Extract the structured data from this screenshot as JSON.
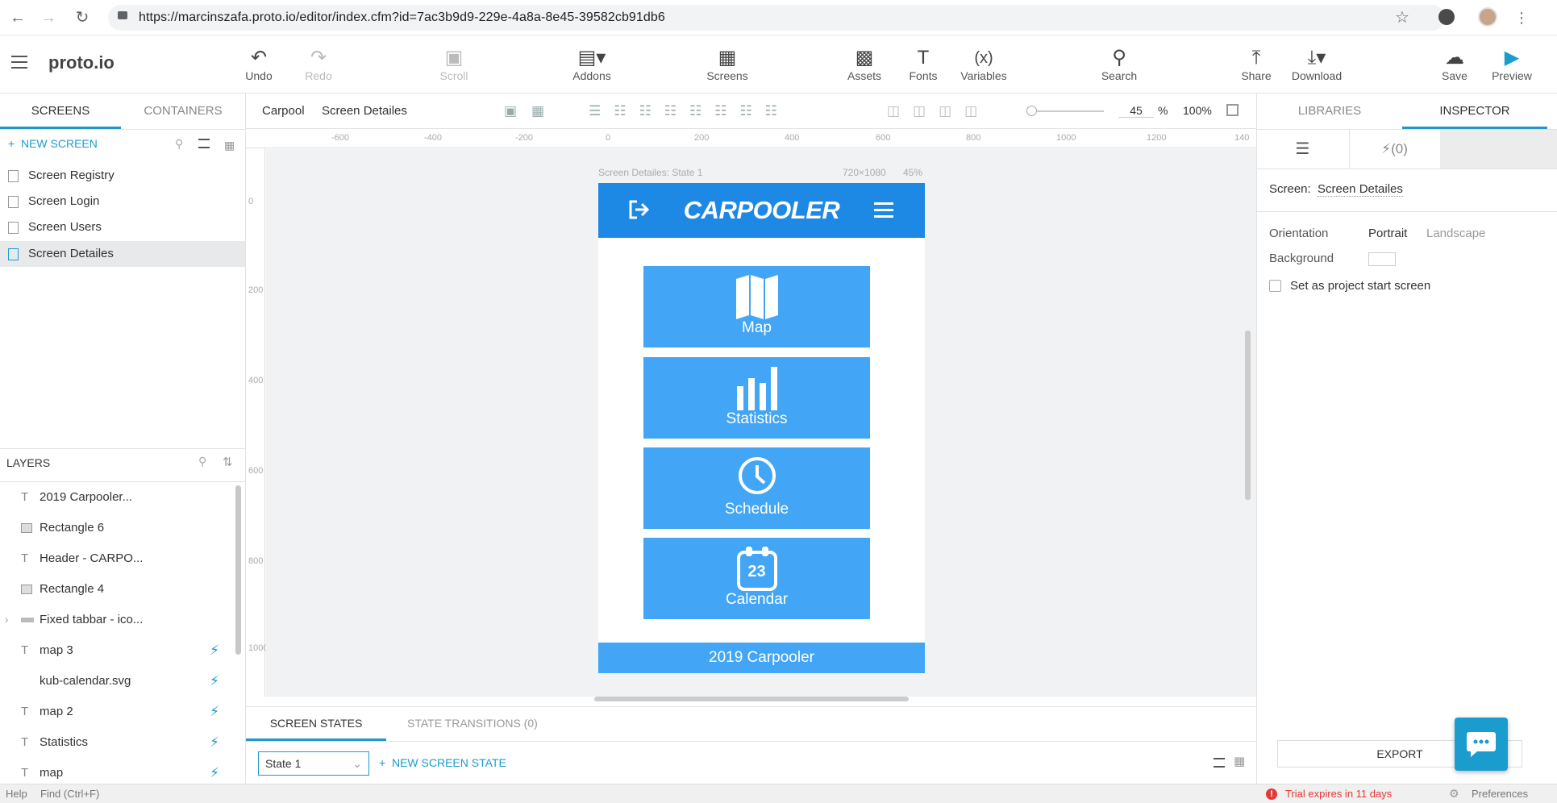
{
  "browser": {
    "url": "https://marcinszafa.proto.io/editor/index.cfm?id=7ac3b9d9-229e-4a8a-8e45-39582cb91db6"
  },
  "app": {
    "logo": "proto.io"
  },
  "toolbar": {
    "undo": "Undo",
    "redo": "Redo",
    "scroll": "Scroll",
    "addons": "Addons",
    "screens": "Screens",
    "assets": "Assets",
    "fonts": "Fonts",
    "variables": "Variables",
    "variables_icon": "(x)",
    "search": "Search",
    "share": "Share",
    "download": "Download",
    "save": "Save",
    "preview": "Preview"
  },
  "left": {
    "tabs": [
      "SCREENS",
      "CONTAINERS"
    ],
    "new_screen": "NEW SCREEN",
    "screens": [
      "Screen Registry",
      "Screen Login",
      "Screen Users",
      "Screen Detailes"
    ],
    "layers_title": "LAYERS",
    "layers": [
      "2019 Carpooler...",
      "Rectangle 6",
      "Header - CARPO...",
      "Rectangle 4",
      "Fixed tabbar - ico...",
      "map 3",
      "kub-calendar.svg",
      "map 2",
      "Statistics",
      "map"
    ]
  },
  "canvasbar": {
    "breadcrumb_project": "Carpool",
    "breadcrumb_screen": "Screen Detailes",
    "zoom_value": "45",
    "zoom_percent": "%",
    "zoom_100": "100%"
  },
  "rulers": {
    "top": [
      "-600",
      "-400",
      "-200",
      "0",
      "200",
      "400",
      "600",
      "800",
      "1000",
      "1200",
      "140"
    ],
    "left": [
      "0",
      "200",
      "400",
      "600",
      "800",
      "1000"
    ]
  },
  "phone": {
    "caption": "Screen Detailes: State 1",
    "size": "720×1080",
    "zoom": "45%",
    "title": "CARPOOLER",
    "tiles": [
      "Map",
      "Statistics",
      "Schedule",
      "Calendar"
    ],
    "calendar_day": "23",
    "footer": "2019 Carpooler"
  },
  "right": {
    "tabs": [
      "LIBRARIES",
      "INSPECTOR"
    ],
    "interactions": "(0)",
    "screen_label": "Screen:",
    "screen_name": "Screen Detailes",
    "orientation_label": "Orientation",
    "portrait": "Portrait",
    "landscape": "Landscape",
    "background_label": "Background",
    "start_screen": "Set as project start screen",
    "export": "EXPORT"
  },
  "states": {
    "tabs": [
      "SCREEN STATES",
      "STATE TRANSITIONS (0)"
    ],
    "selected_state": "State 1",
    "new_state": "NEW SCREEN STATE"
  },
  "status": {
    "help": "Help",
    "find": "Find (Ctrl+F)",
    "trial": "Trial expires in 11 days",
    "preferences": "Preferences"
  },
  "colors": {
    "accent": "#2196c9",
    "header_blue": "#1e88e5",
    "tile_blue": "#42a5f5",
    "warning": "#e53935"
  }
}
